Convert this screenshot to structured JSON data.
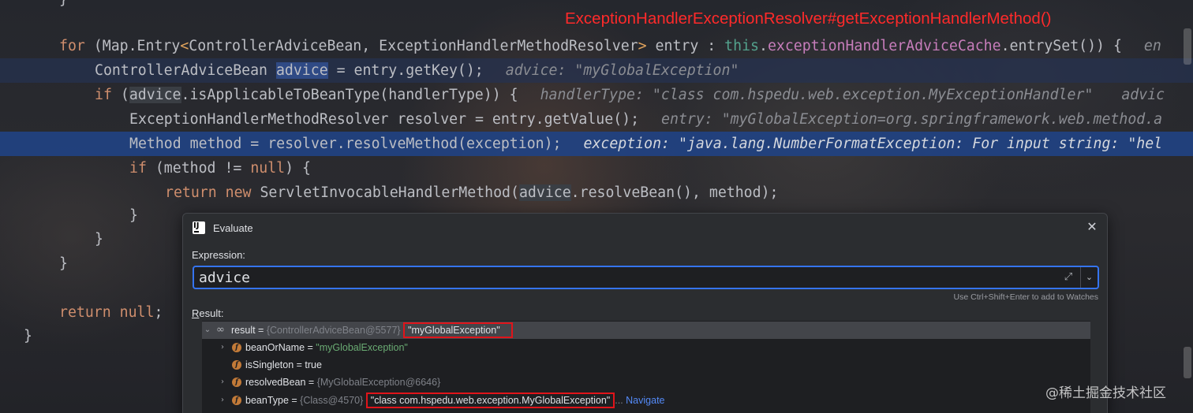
{
  "annotation": "ExceptionHandlerExceptionResolver#getExceptionHandlerMethod()",
  "code": {
    "line0_brace": "}",
    "for_kw": "for",
    "for_open": " (Map.Entry",
    "for_lt": "<",
    "for_types": "ControllerAdviceBean, ExceptionHandlerMethodResolver",
    "for_gt": ">",
    "for_entry": " entry : ",
    "for_this": "this",
    "for_dot": ".",
    "for_field": "exceptionHandlerAdviceCache",
    "for_call": ".entrySet()) {",
    "for_hint": "en",
    "l2_type": "ControllerAdviceBean ",
    "l2_var": "advice",
    "l2_rest": " = entry.getKey();",
    "l2_hint": "advice: \"myGlobalException\"",
    "l3_if": "if",
    "l3_open": " (",
    "l3_advice": "advice",
    "l3_rest": ".isApplicableToBeanType(handlerType)) {",
    "l3_hint": "handlerType: \"class com.hspedu.web.exception.MyExceptionHandler\"",
    "l3_hint2": "advic",
    "l4_code": "ExceptionHandlerMethodResolver resolver = entry.getValue();",
    "l4_hint": "entry: \"myGlobalException=org.springframework.web.method.a",
    "l5_code": "Method method = resolver.resolveMethod(exception);",
    "l5_hint": "exception: \"java.lang.NumberFormatException: For input string: \"hel",
    "l6_if": "if",
    "l6_open": " (method != ",
    "l6_null": "null",
    "l6_close": ") {",
    "l7_return": "return",
    "l7_new": "new",
    "l7_code1": " ServletInvocableHandlerMethod(",
    "l7_advice": "advice",
    "l7_code2": ".resolveBean(), method);",
    "l8_brace": "}",
    "l9_brace": "}",
    "l10_brace": "}",
    "l11_return": "return",
    "l11_null": "null",
    "l11_semi": ";",
    "l12_brace": "}"
  },
  "dialog": {
    "title": "Evaluate",
    "close_icon": "close-icon",
    "expression_label": "Expression:",
    "expression_value": "advice",
    "expand_icon": "expand-icon",
    "history_icon": "chevron-down-icon",
    "watch_hint": "Use Ctrl+Shift+Enter to add to Watches",
    "result_label_mnemonic": "R",
    "result_label_rest": "esult:",
    "tree": [
      {
        "name": "result",
        "meta": "{ControllerAdviceBean@5577}",
        "value": "\"myGlobalException\"",
        "expanded": true,
        "icon": "watch-result-icon"
      },
      {
        "name": "beanOrName",
        "value": "\"myGlobalException\"",
        "expanded": false,
        "icon": "field-icon"
      },
      {
        "name": "isSingleton",
        "value": "true",
        "icon": "field-icon"
      },
      {
        "name": "resolvedBean",
        "meta": "{MyGlobalException@6646}",
        "expanded": false,
        "icon": "field-icon"
      },
      {
        "name": "beanType",
        "meta": "{Class@4570}",
        "value": "\"class com.hspedu.web.exception.MyGlobalException\"",
        "value_suffix": "...",
        "link": "Navigate",
        "expanded": false,
        "icon": "field-icon"
      }
    ]
  },
  "watermark": "@稀土掘金技术社区"
}
